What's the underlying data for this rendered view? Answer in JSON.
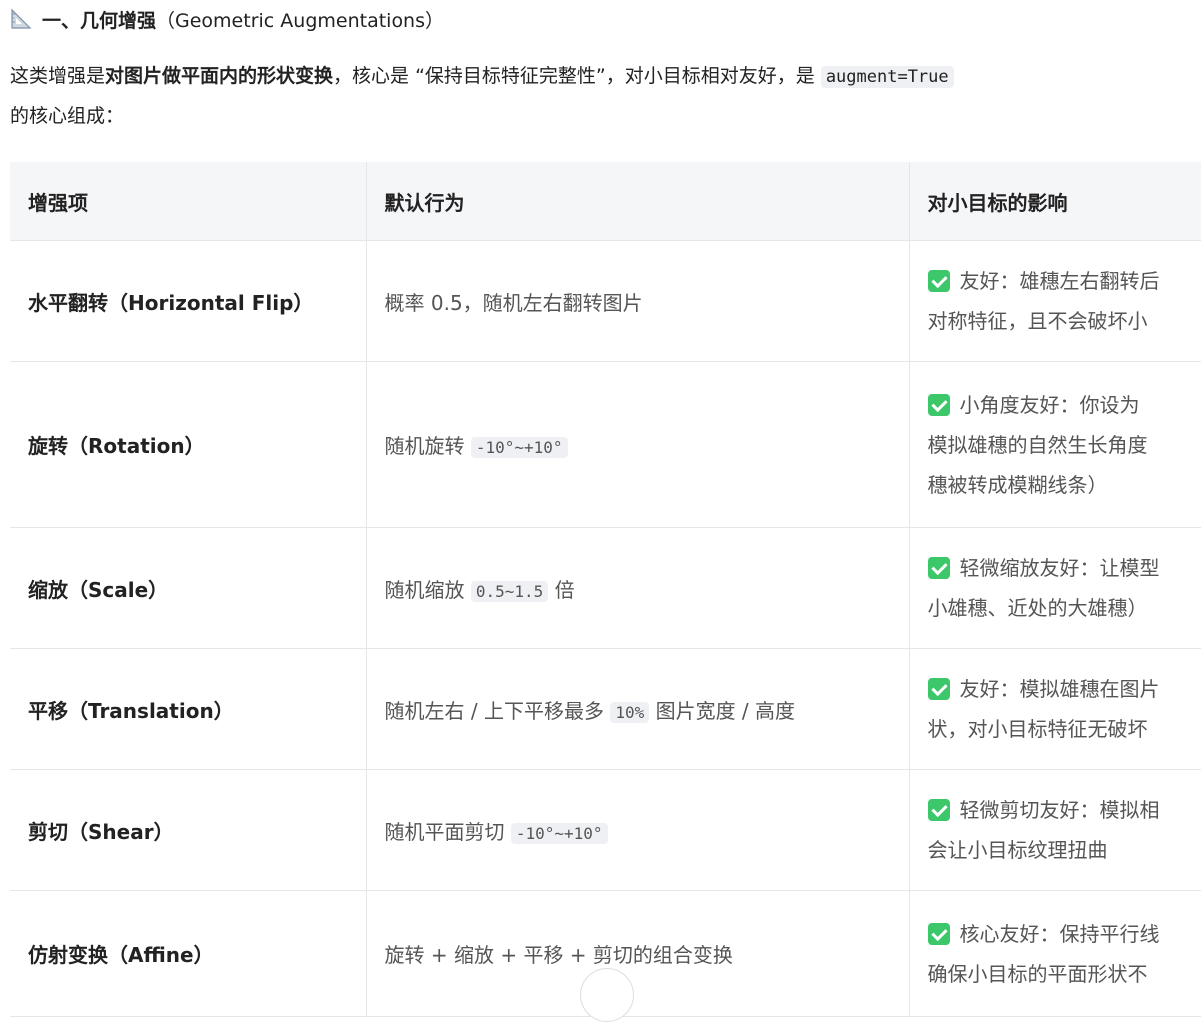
{
  "heading": {
    "icon": "triangular-ruler-icon",
    "title_cn": "一、几何增强",
    "title_en": "（Geometric Augmentations）"
  },
  "intro": {
    "part1": "这类增强是",
    "bold": "对图片做平面内的形状变换",
    "part2": "，核心是 “保持目标特征完整性”，对小目标相对友好，是 ",
    "code": "augment=True",
    "part3": "的核心组成："
  },
  "table": {
    "headers": [
      "增强项",
      "默认行为",
      "对小目标的影响"
    ],
    "rows": [
      {
        "name": "水平翻转（Horizontal Flip）",
        "behavior_pre": "概率 0.5，随机左右翻转图片",
        "behavior_code": "",
        "behavior_post": "",
        "impact_lines": [
          "友好：雄穗左右翻转后",
          "对称特征，且不会破坏小"
        ]
      },
      {
        "name": "旋转（Rotation）",
        "behavior_pre": "随机旋转 ",
        "behavior_code": "-10°~+10°",
        "behavior_post": "",
        "impact_lines": [
          "小角度友好：你设为",
          "模拟雄穗的自然生长角度",
          "穗被转成模糊线条）"
        ]
      },
      {
        "name": "缩放（Scale）",
        "behavior_pre": "随机缩放 ",
        "behavior_code": "0.5~1.5",
        "behavior_post": " 倍",
        "impact_lines": [
          "轻微缩放友好：让模型",
          "小雄穗、近处的大雄穗）"
        ]
      },
      {
        "name": "平移（Translation）",
        "behavior_pre": "随机左右 / 上下平移最多 ",
        "behavior_code": "10%",
        "behavior_post": " 图片宽度 / 高度",
        "impact_lines": [
          "友好：模拟雄穗在图片",
          "状，对小目标特征无破坏"
        ]
      },
      {
        "name": "剪切（Shear）",
        "behavior_pre": "随机平面剪切 ",
        "behavior_code": "-10°~+10°",
        "behavior_post": "",
        "impact_lines": [
          "轻微剪切友好：模拟相",
          "会让小目标纹理扭曲"
        ]
      },
      {
        "name": "仿射变换（Affine）",
        "behavior_pre": "旋转 + 缩放 + 平移 + 剪切的组合变换",
        "behavior_code": "",
        "behavior_post": "",
        "impact_lines": [
          "核心友好：保持平行线",
          "确保小目标的平面形状不"
        ]
      }
    ]
  }
}
